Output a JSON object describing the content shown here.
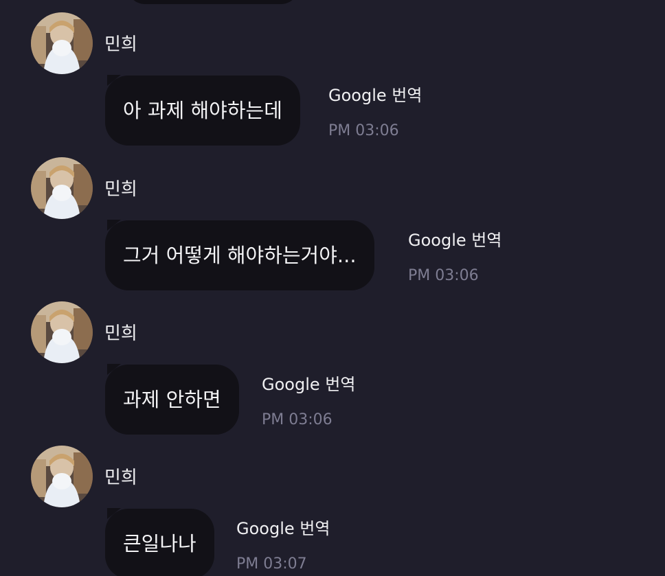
{
  "messages": [
    {
      "sender": "민희",
      "text": "아 과제 해야하는데",
      "translate_label": "Google 번역",
      "time": "PM 03:06"
    },
    {
      "sender": "민희",
      "text": "그거 어떻게 해야하는거야...",
      "translate_label": "Google 번역",
      "time": "PM 03:06"
    },
    {
      "sender": "민희",
      "text": "과제 안하면",
      "translate_label": "Google 번역",
      "time": "PM 03:06"
    },
    {
      "sender": "민희",
      "text": "큰일나나",
      "translate_label": "Google 번역",
      "time": "PM 03:07"
    }
  ],
  "colors": {
    "background": "#1f1e2b",
    "bubble": "#121117",
    "text": "#f4f4f6",
    "timestamp": "#7e7d92"
  },
  "icons": {
    "avatar": "profile-photo"
  }
}
